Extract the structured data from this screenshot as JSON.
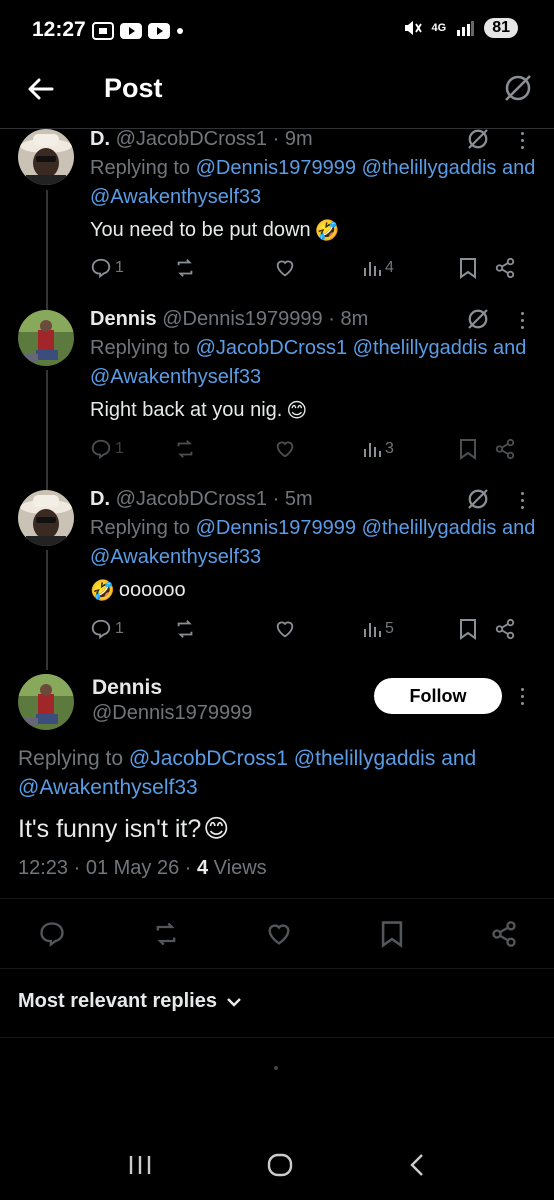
{
  "status_bar": {
    "time": "12:27",
    "network": "4G",
    "battery": "81"
  },
  "header": {
    "title": "Post"
  },
  "thread": [
    {
      "display_name": "D.",
      "handle": "@JacobDCross1",
      "time": "9m",
      "replying_prefix": "Replying to",
      "mention_1": "@Dennis1979999",
      "mention_2": "@thelillygaddis",
      "and_word": "and",
      "mention_3": "@Awakenthyself33",
      "text": "You need to be put down",
      "emoji": "🤣",
      "replies": "1",
      "views": "4"
    },
    {
      "display_name": "Dennis",
      "handle": "@Dennis1979999",
      "time": "8m",
      "replying_prefix": "Replying to",
      "mention_1": "@JacobDCross1",
      "mention_2": "@thelillygaddis",
      "and_word": "and",
      "mention_3": "@Awakenthyself33",
      "text": "Right back at you nig.",
      "emoji": "😊",
      "replies": "1",
      "views": "3"
    },
    {
      "display_name": "D.",
      "handle": "@JacobDCross1",
      "time": "5m",
      "replying_prefix": "Replying to",
      "mention_1": "@Dennis1979999",
      "mention_2": "@thelillygaddis",
      "and_word": "and",
      "mention_3": "@Awakenthyself33",
      "emoji": "🤣",
      "text": "oooooo",
      "replies": "1",
      "views": "5"
    }
  ],
  "main_post": {
    "display_name": "Dennis",
    "handle": "@Dennis1979999",
    "follow_label": "Follow",
    "replying_prefix": "Replying to",
    "mention_1": "@JacobDCross1",
    "mention_2": "@thelillygaddis",
    "and_word": "and",
    "mention_3": "@Awakenthyself33",
    "text": "It's funny isn't it?",
    "emoji": "😊",
    "timestamp": "12:23 · 01 May 26 · ",
    "views_count": "4",
    "views_label": " Views"
  },
  "sort": {
    "label": "Most relevant replies"
  },
  "colors": {
    "background": "#000000",
    "mention": "#5a9de6",
    "muted": "#71767b",
    "text": "#e7e9ea"
  }
}
